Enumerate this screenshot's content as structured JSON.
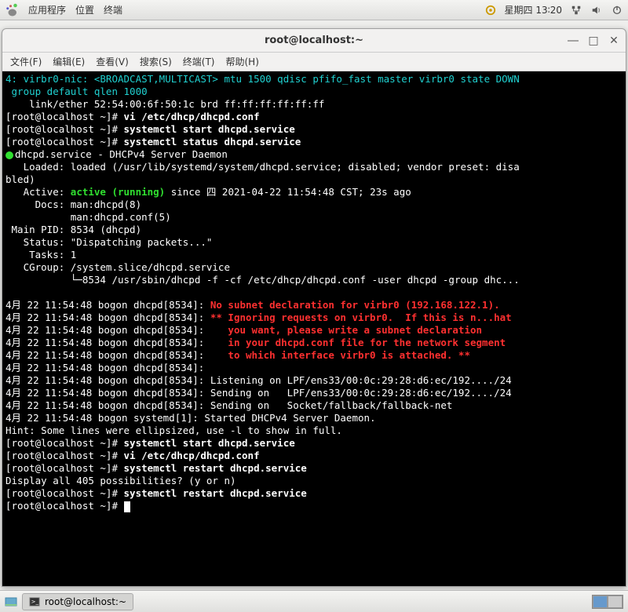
{
  "panel": {
    "apps": "应用程序",
    "places": "位置",
    "terminal": "终端",
    "clock": "星期四 13∶20"
  },
  "window": {
    "title": "root@localhost:~"
  },
  "menubar": {
    "file": "文件(F)",
    "edit": "编辑(E)",
    "view": "查看(V)",
    "search": "搜索(S)",
    "terminal": "终端(T)",
    "help": "帮助(H)"
  },
  "term": {
    "l1": "4: virbr0-nic: <BROADCAST,MULTICAST> mtu 1500 qdisc pfifo_fast master virbr0 state DOWN",
    "l2": " group default qlen 1000",
    "l3": "    link/ether 52:54:00:6f:50:1c brd ff:ff:ff:ff:ff:ff",
    "p1a": "[root@localhost ~]# ",
    "p1b": "vi /etc/dhcp/dhcpd.conf",
    "p2a": "[root@localhost ~]# ",
    "p2b": "systemctl start dhcpd.service",
    "p3a": "[root@localhost ~]# ",
    "p3b": "systemctl status dhcpd.service",
    "s1": "dhcpd.service - DHCPv4 Server Daemon",
    "s2": "   Loaded: loaded (/usr/lib/systemd/system/dhcpd.service; disabled; vendor preset: disa",
    "s2b": "bled)",
    "s3a": "   Active: ",
    "s3b": "active (running)",
    "s3c": " since 四 2021-04-22 11:54:48 CST; 23s ago",
    "s4": "     Docs: man:dhcpd(8)",
    "s5": "           man:dhcpd.conf(5)",
    "s6": " Main PID: 8534 (dhcpd)",
    "s7": "   Status: \"Dispatching packets...\"",
    "s8": "    Tasks: 1",
    "s9": "   CGroup: /system.slice/dhcpd.service",
    "s10": "           └─8534 /usr/sbin/dhcpd -f -cf /etc/dhcp/dhcpd.conf -user dhcpd -group dhc...",
    "log_prefix": "4月 22 11:54:48 bogon dhcpd[8534]: ",
    "r1": "No subnet declaration for virbr0 (192.168.122.1).",
    "r2": "** Ignoring requests on virbr0.  If this is n...hat",
    "r3": "   you want, please write a subnet declaration",
    "r4": "   in your dhcpd.conf file for the network segment",
    "r5": "   to which interface virbr0 is attached. **",
    "l_empty": "4月 22 11:54:48 bogon dhcpd[8534]: ",
    "ll1": "4月 22 11:54:48 bogon dhcpd[8534]: Listening on LPF/ens33/00:0c:29:28:d6:ec/192..../24",
    "ll2": "4月 22 11:54:48 bogon dhcpd[8534]: Sending on   LPF/ens33/00:0c:29:28:d6:ec/192..../24",
    "ll3": "4月 22 11:54:48 bogon dhcpd[8534]: Sending on   Socket/fallback/fallback-net",
    "ll4": "4月 22 11:54:48 bogon systemd[1]: Started DHCPv4 Server Daemon.",
    "hint": "Hint: Some lines were ellipsized, use -l to show in full.",
    "p4a": "[root@localhost ~]# ",
    "p4b": "systemctl start dhcpd.service",
    "p5a": "[root@localhost ~]# ",
    "p5b": "vi /etc/dhcp/dhcpd.conf",
    "p6a": "[root@localhost ~]# ",
    "p6b": "systemctl restart dhcpd.service",
    "disp": "Display all 405 possibilities? (y or n)",
    "p7a": "[root@localhost ~]# ",
    "p7b": "systemctl restart dhcpd.service",
    "p8a": "[root@localhost ~]# "
  },
  "taskbar": {
    "task": "root@localhost:~"
  }
}
